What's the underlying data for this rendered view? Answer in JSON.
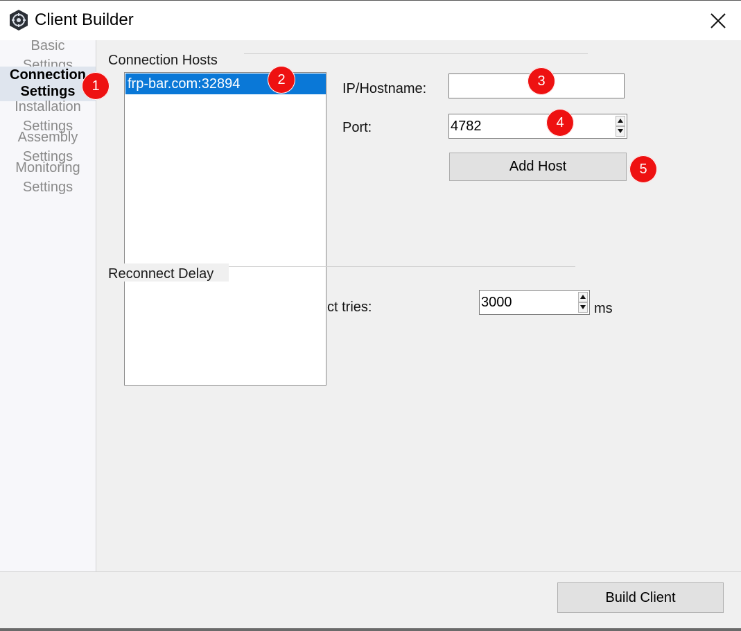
{
  "window": {
    "title": "Client Builder"
  },
  "sidebar": {
    "items": [
      {
        "line1": "Basic",
        "line2": "Settings"
      },
      {
        "line1": "Connection",
        "line2": "Settings"
      },
      {
        "line1": "Installation",
        "line2": "Settings"
      },
      {
        "line1": "Assembly",
        "line2": "Settings"
      },
      {
        "line1": "Monitoring",
        "line2": "Settings"
      }
    ]
  },
  "connection_hosts": {
    "group_title": "Connection Hosts",
    "hosts": [
      "frp-bar.com:32894"
    ],
    "ip_label": "IP/Hostname:",
    "ip_value": "",
    "port_label": "Port:",
    "port_value": "4782",
    "add_button": "Add Host"
  },
  "reconnect_delay": {
    "group_title": "Reconnect Delay",
    "label_partial": "ct tries:",
    "value": "3000",
    "unit": "ms"
  },
  "footer": {
    "build_button": "Build Client"
  },
  "annotations": [
    "1",
    "2",
    "3",
    "4",
    "5"
  ],
  "colors": {
    "selection": "#0a78d7",
    "badge": "#ee1111",
    "sidebar_active": "#dfe5ee"
  },
  "icons": [
    "app-logo-icon",
    "close-icon",
    "spin-up-icon",
    "spin-down-icon"
  ]
}
